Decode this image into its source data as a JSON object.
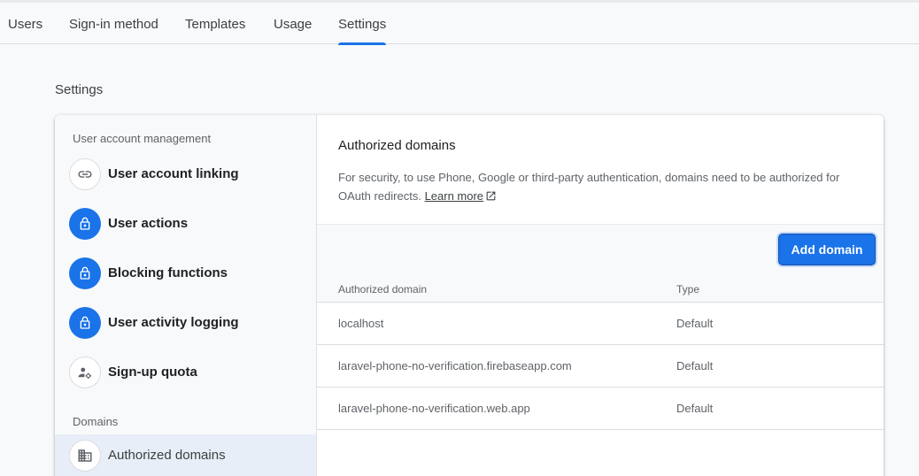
{
  "tabs": [
    {
      "label": "Users"
    },
    {
      "label": "Sign-in method"
    },
    {
      "label": "Templates"
    },
    {
      "label": "Usage"
    },
    {
      "label": "Settings"
    }
  ],
  "active_tab": "Settings",
  "page_title": "Settings",
  "sidebar": {
    "section_user_account": "User account management",
    "items": [
      {
        "label": "User account linking",
        "icon": "link-icon"
      },
      {
        "label": "User actions",
        "icon": "lock-icon"
      },
      {
        "label": "Blocking functions",
        "icon": "lock-icon"
      },
      {
        "label": "User activity logging",
        "icon": "lock-icon"
      },
      {
        "label": "Sign-up quota",
        "icon": "user-settings-icon"
      }
    ],
    "section_domains": "Domains",
    "domain_items": [
      {
        "label": "Authorized domains",
        "icon": "building-icon"
      }
    ]
  },
  "main": {
    "title": "Authorized domains",
    "description": "For security, to use Phone, Google or third-party authentication, domains need to be authorized for OAuth redirects.",
    "learn_more": "Learn more",
    "add_button": "Add domain",
    "columns": [
      "Authorized domain",
      "Type"
    ],
    "rows": [
      {
        "domain": "localhost",
        "type": "Default"
      },
      {
        "domain": "laravel-phone-no-verification.firebaseapp.com",
        "type": "Default"
      },
      {
        "domain": "laravel-phone-no-verification.web.app",
        "type": "Default"
      }
    ]
  },
  "colors": {
    "accent": "#1a73e8",
    "selected_bg": "#e8eef7",
    "page_bg": "#f8f9fa"
  }
}
